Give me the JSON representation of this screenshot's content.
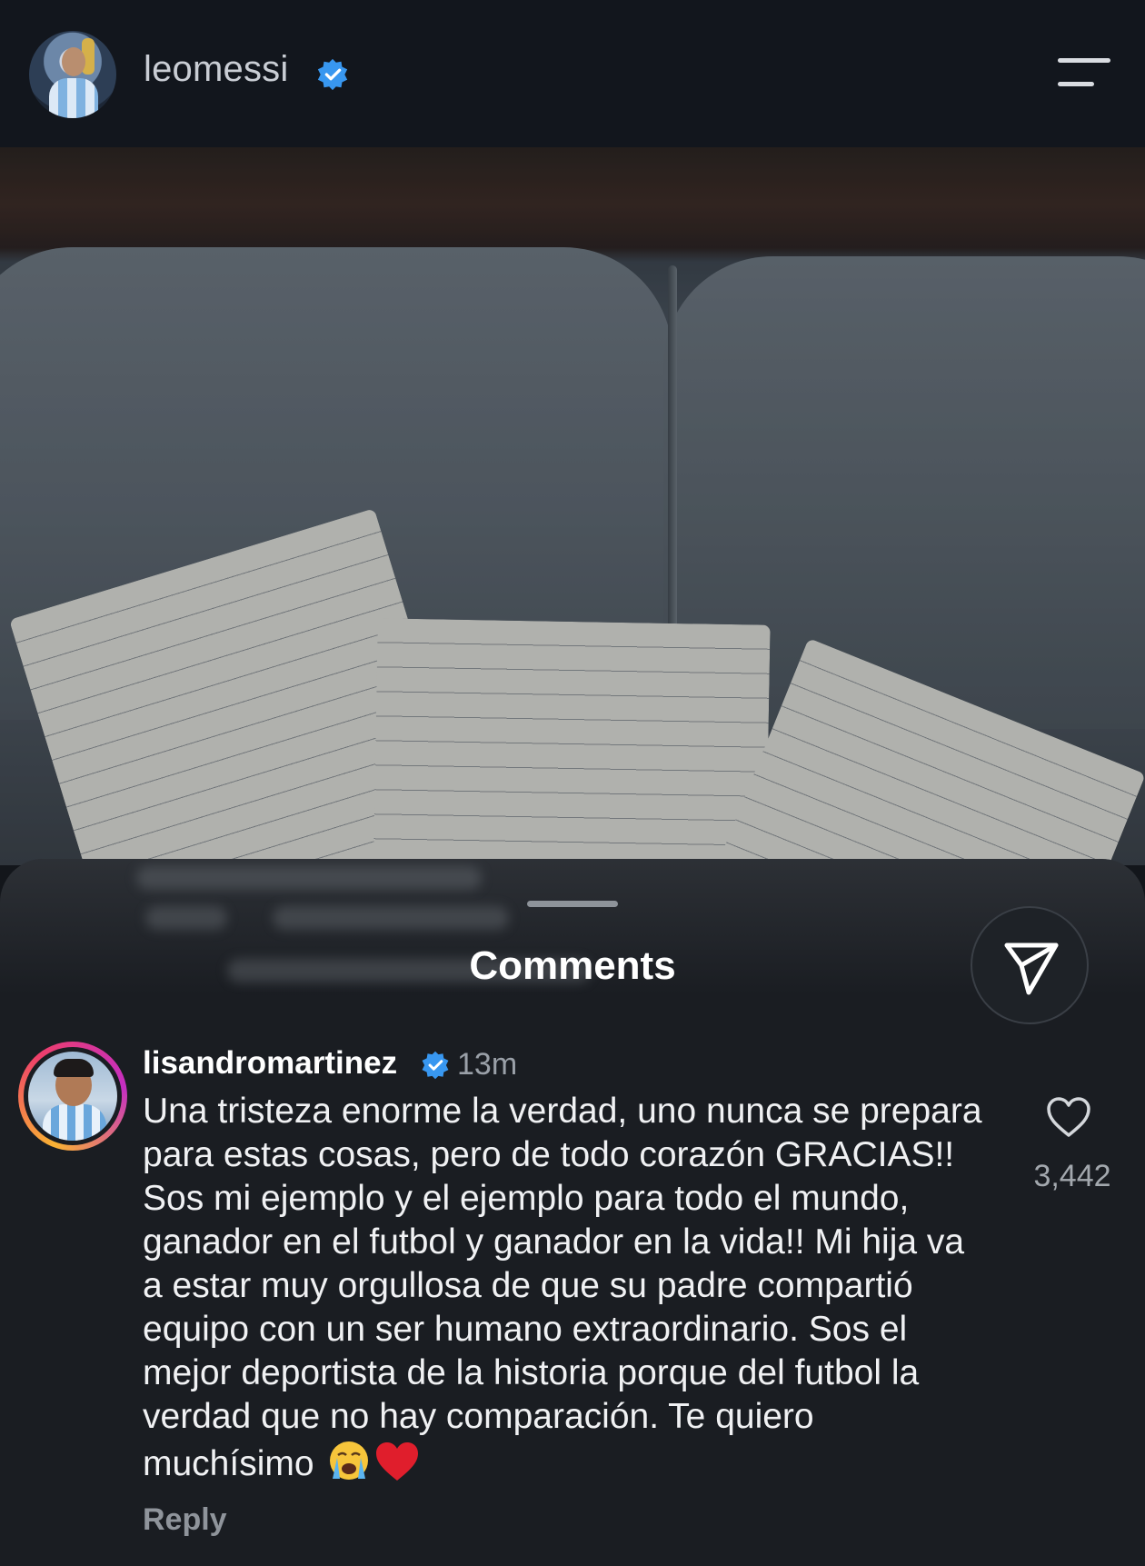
{
  "header": {
    "username": "leomessi",
    "verified": true
  },
  "photo": {
    "description_icon": "photo-of-handwritten-notes"
  },
  "sheet": {
    "title": "Comments"
  },
  "comment": {
    "username": "lisandromartinez",
    "verified": true,
    "time": "13m",
    "text": "Una tristeza enorme la verdad, uno nunca se prepara para estas cosas, pero de todo corazón GRACIAS!! Sos mi ejemplo y el ejemplo para todo el mundo, ganador en el futbol y ganador en la vida!! Mi hija va a estar muy orgullosa de que su padre compartió equipo con un ser humano extraordinario. Sos el mejor deportista de la historia porque del futbol la verdad que no hay comparación. Te quiero muchísimo",
    "likes": "3,442",
    "reply_label": "Reply"
  },
  "colors": {
    "verified_blue": "#3897f0",
    "background": "#13161b",
    "sheet": "#1a1d22"
  }
}
